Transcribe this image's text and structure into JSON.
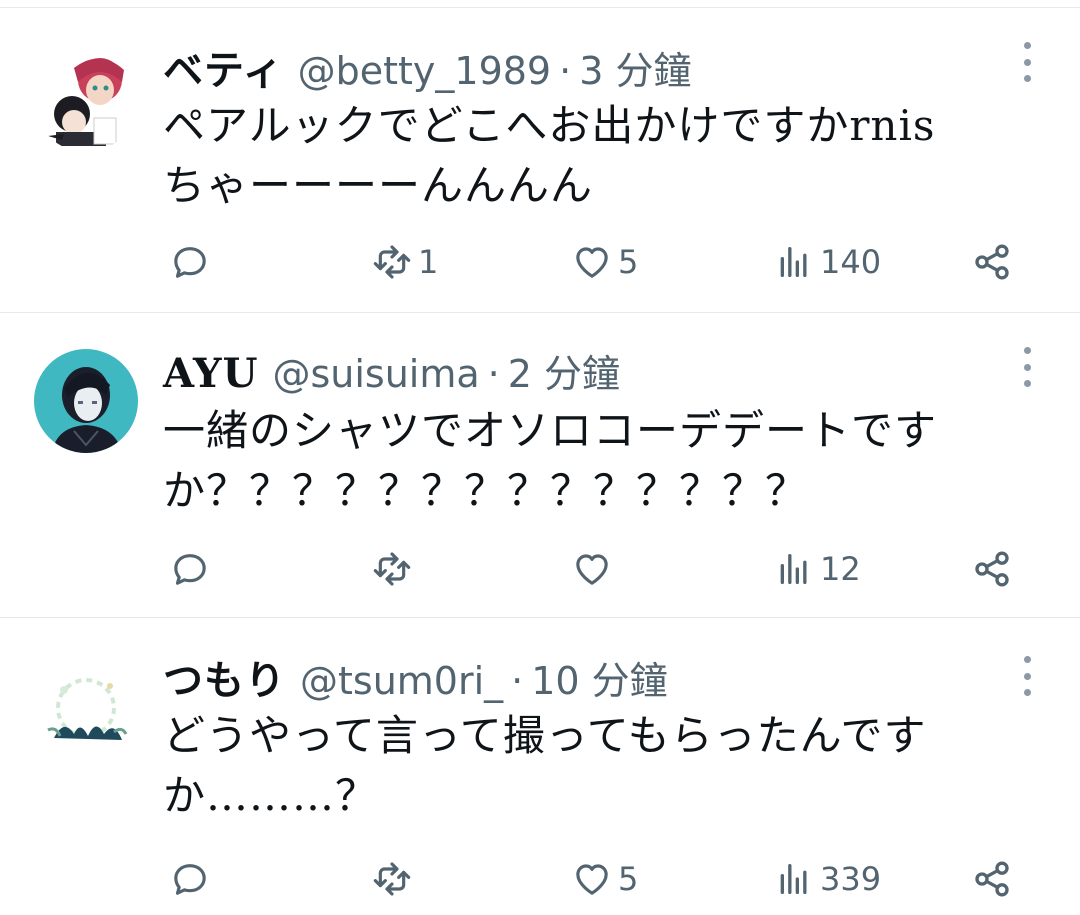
{
  "tweets": [
    {
      "name": "ベティ",
      "handle": "@betty_1989",
      "separator": "·",
      "time": "3 分鐘",
      "text": "ペアルックでどこへお出かけですかrnis\nちゃーーーーんんんん",
      "reply_count": "",
      "retweet_count": "1",
      "like_count": "5",
      "view_count": "140"
    },
    {
      "name": "AYU",
      "handle": "@suisuima",
      "separator": "·",
      "time": "2 分鐘",
      "text": "一緒のシャツでオソロコーデデートです\nか？？？？？？？？？？？？？？",
      "reply_count": "",
      "retweet_count": "",
      "like_count": "",
      "view_count": "12"
    },
    {
      "name": "つもり",
      "handle": "@tsum0ri_",
      "separator": "·",
      "time": "10 分鐘",
      "text": "どうやって言って撮ってもらったんです\nか………？",
      "reply_count": "",
      "retweet_count": "",
      "like_count": "5",
      "view_count": "339"
    }
  ],
  "icons": {
    "reply": "speech-bubble-icon",
    "retweet": "retweet-arrows-icon",
    "like": "heart-icon",
    "views": "bar-chart-icon",
    "share": "share-icon",
    "more": "vertical-dots-icon"
  },
  "colors": {
    "text": "#0f1419",
    "secondary": "#536471",
    "divider": "#e6e9ec",
    "avatar2_bg": "#3fb8c2"
  }
}
